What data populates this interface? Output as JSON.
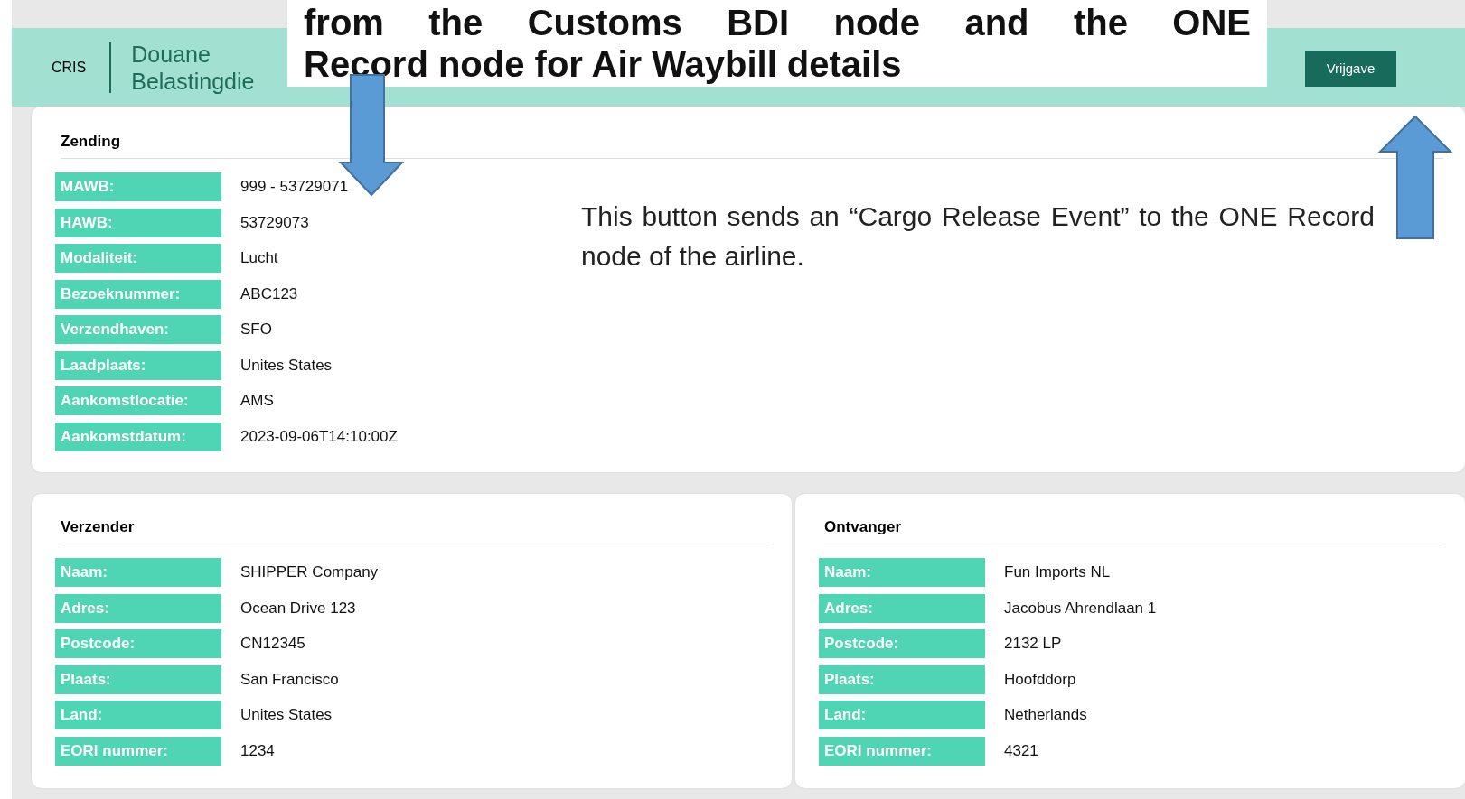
{
  "header": {
    "logo": "CRIS",
    "org_lines": [
      "Douane",
      "Belastingdie"
    ],
    "button": "Vrijgave"
  },
  "sections": [
    {
      "title": "Zending",
      "fields": [
        {
          "label": "MAWB:",
          "value": "999 - 53729071"
        },
        {
          "label": "HAWB:",
          "value": "53729073"
        },
        {
          "label": "Modaliteit:",
          "value": "Lucht"
        },
        {
          "label": "Bezoeknummer:",
          "value": "ABC123"
        },
        {
          "label": "Verzendhaven:",
          "value": "SFO"
        },
        {
          "label": "Laadplaats:",
          "value": "Unites States"
        },
        {
          "label": "Aankomstlocatie:",
          "value": "AMS"
        },
        {
          "label": "Aankomstdatum:",
          "value": "2023-09-06T14:10:00Z"
        }
      ]
    },
    {
      "title": "Verzender",
      "fields": [
        {
          "label": "Naam:",
          "value": "SHIPPER Company"
        },
        {
          "label": "Adres:",
          "value": "Ocean Drive 123"
        },
        {
          "label": "Postcode:",
          "value": "CN12345"
        },
        {
          "label": "Plaats:",
          "value": "San Francisco"
        },
        {
          "label": "Land:",
          "value": "Unites States"
        },
        {
          "label": "EORI nummer:",
          "value": "1234"
        }
      ]
    },
    {
      "title": "Ontvanger",
      "fields": [
        {
          "label": "Naam:",
          "value": "Fun Imports NL"
        },
        {
          "label": "Adres:",
          "value": "Jacobus Ahrendlaan 1"
        },
        {
          "label": "Postcode:",
          "value": "2132 LP"
        },
        {
          "label": "Plaats:",
          "value": "Hoofddorp"
        },
        {
          "label": "Land:",
          "value": "Netherlands"
        },
        {
          "label": "EORI nummer:",
          "value": "4321"
        }
      ]
    }
  ],
  "annotations": {
    "title_lines": [
      "from the Customs BDI node and the ONE",
      "Record node for Air Waybill details"
    ],
    "note": "This button sends an “Cargo Release Event” to the ONE Record node of the airline."
  }
}
